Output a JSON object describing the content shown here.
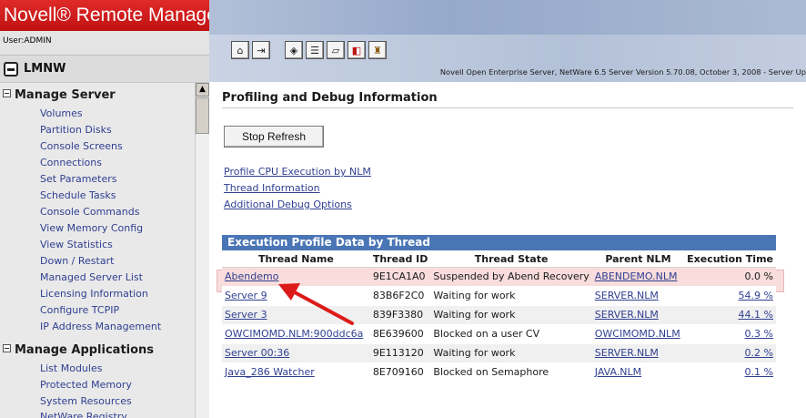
{
  "app": {
    "brand": "Novell® Remote Manager",
    "user_line": "User:ADMIN",
    "server_name": "LMNW",
    "version_line": "Novell Open Enterprise Server, NetWare 6.5  Server Version 5.70.08, October 3, 2008 - Server Up"
  },
  "toolbar": {
    "buttons": [
      {
        "icon": "home-icon",
        "glyph": "⌂"
      },
      {
        "icon": "exit-icon",
        "glyph": "⇥"
      },
      {
        "icon": "health-monitor-icon",
        "glyph": "◈"
      },
      {
        "icon": "config-report-icon",
        "glyph": "☰"
      },
      {
        "icon": "volume-icon",
        "glyph": "▱"
      },
      {
        "icon": "down-server-icon",
        "glyph": "◧"
      },
      {
        "icon": "lock-icon",
        "glyph": "♜"
      }
    ]
  },
  "sidebar": {
    "sections": [
      {
        "label": "Manage Server",
        "items": [
          "Volumes",
          "Partition Disks",
          "Console Screens",
          "Connections",
          "Set Parameters",
          "Schedule Tasks",
          "Console Commands",
          "View Memory Config",
          "View Statistics",
          "Down / Restart",
          "Managed Server List",
          "Licensing Information",
          "Configure TCPIP",
          "IP Address Management"
        ]
      },
      {
        "label": "Manage Applications",
        "items": [
          "List Modules",
          "Protected Memory",
          "System Resources",
          "NetWare Registry"
        ]
      }
    ]
  },
  "content": {
    "page_title": "Profiling and Debug Information",
    "stop_refresh_label": "Stop Refresh",
    "links": [
      "Profile CPU Execution by NLM",
      "Thread Information",
      "Additional Debug Options"
    ]
  },
  "table": {
    "title": "Execution Profile Data by Thread",
    "columns": [
      "Thread Name",
      "Thread ID",
      "Thread State",
      "Parent NLM",
      "Execution Time"
    ],
    "rows": [
      {
        "name": "Abendemo",
        "id": "9E1CA1A0",
        "state": "Suspended by Abend Recovery",
        "nlm": "ABENDEMO.NLM",
        "time": "0.0 %"
      },
      {
        "name": "Server 9",
        "id": "83B6F2C0",
        "state": "Waiting for work",
        "nlm": "SERVER.NLM",
        "time": "54.9 %"
      },
      {
        "name": "Server 3",
        "id": "839F3380",
        "state": "Waiting for work",
        "nlm": "SERVER.NLM",
        "time": "44.1 %"
      },
      {
        "name": "OWCIMOMD.NLM:900ddc6a",
        "id": "8E639600",
        "state": "Blocked on a user CV",
        "nlm": "OWCIMOMD.NLM",
        "time": "0.3 %"
      },
      {
        "name": "Server 00:36",
        "id": "9E113120",
        "state": "Waiting for work",
        "nlm": "SERVER.NLM",
        "time": "0.2 %"
      },
      {
        "name": "Java_286 Watcher",
        "id": "8E709160",
        "state": "Blocked on Semaphore",
        "nlm": "JAVA.NLM",
        "time": "0.1 %"
      }
    ]
  },
  "colors": {
    "brand_red": "#c8161a",
    "link_blue": "#2f3f91",
    "table_header_blue": "#4a76b5",
    "highlight_pink": "#f9dcdc",
    "annotation_red": "#dd1a1a"
  }
}
